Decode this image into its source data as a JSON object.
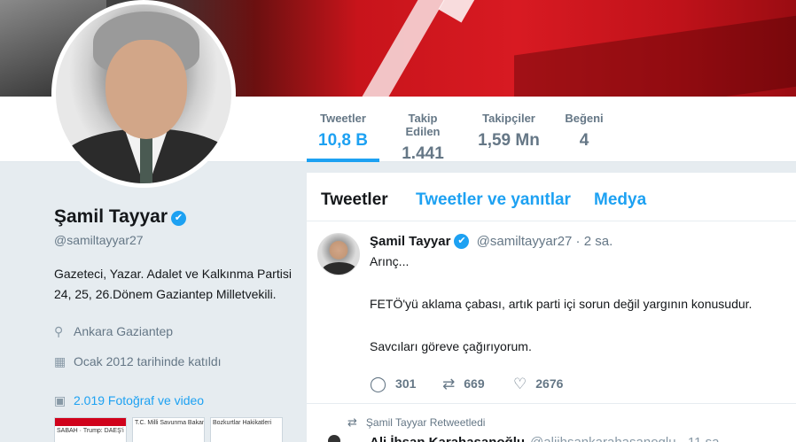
{
  "profile": {
    "name": "Şamil Tayyar",
    "verified_icon": "✔",
    "handle": "@samiltayyar27",
    "bio_line1": "Gazeteci, Yazar. Adalet ve Kalkınma Partisi",
    "bio_line2": "24, 25, 26.Dönem Gaziantep Milletvekili.",
    "location": "Ankara Gaziantep",
    "joined": "Ocak 2012 tarihinde katıldı",
    "photos": "2.019 Fotoğraf ve video",
    "thumb1": "SABAH · Trump: DAEŞ'i Obama kurdu",
    "thumb2": "T.C. Milli Savunma Bakanlığı",
    "thumb3": "Bozkurtlar Hakikatleri"
  },
  "stats": [
    {
      "label": "Tweetler",
      "value": "10,8 B"
    },
    {
      "label": "Takip Edilen",
      "value": "1.441"
    },
    {
      "label": "Takipçiler",
      "value": "1,59 Mn"
    },
    {
      "label": "Beğeni",
      "value": "4"
    }
  ],
  "tabs": [
    "Tweetler",
    "Tweetler ve yanıtlar",
    "Medya"
  ],
  "tweet": {
    "name": "Şamil Tayyar",
    "handle_time": "@samiltayyar27 · 2 sa.",
    "line1": "Arınç...",
    "line2": "FETÖ'yü aklama çabası, artık parti içi sorun değil yargının konusudur.",
    "line3": "Savcıları göreve çağırıyorum.",
    "replies": "301",
    "retweets": "669",
    "likes": "2676"
  },
  "retweet_note": "Şamil Tayyar Retweetledi",
  "next_tweet": {
    "name": "Ali İhsan Karahasanoğlu",
    "handle": "@aliihsankarahasanoglu · 11 sa."
  },
  "icons": {
    "location": "location-pin-icon",
    "calendar": "calendar-icon",
    "photos": "image-icon",
    "reply": "reply-icon",
    "retweet": "retweet-icon",
    "like": "heart-icon"
  },
  "colors": {
    "accent": "#1da1f2",
    "banner": "#d81a22"
  }
}
